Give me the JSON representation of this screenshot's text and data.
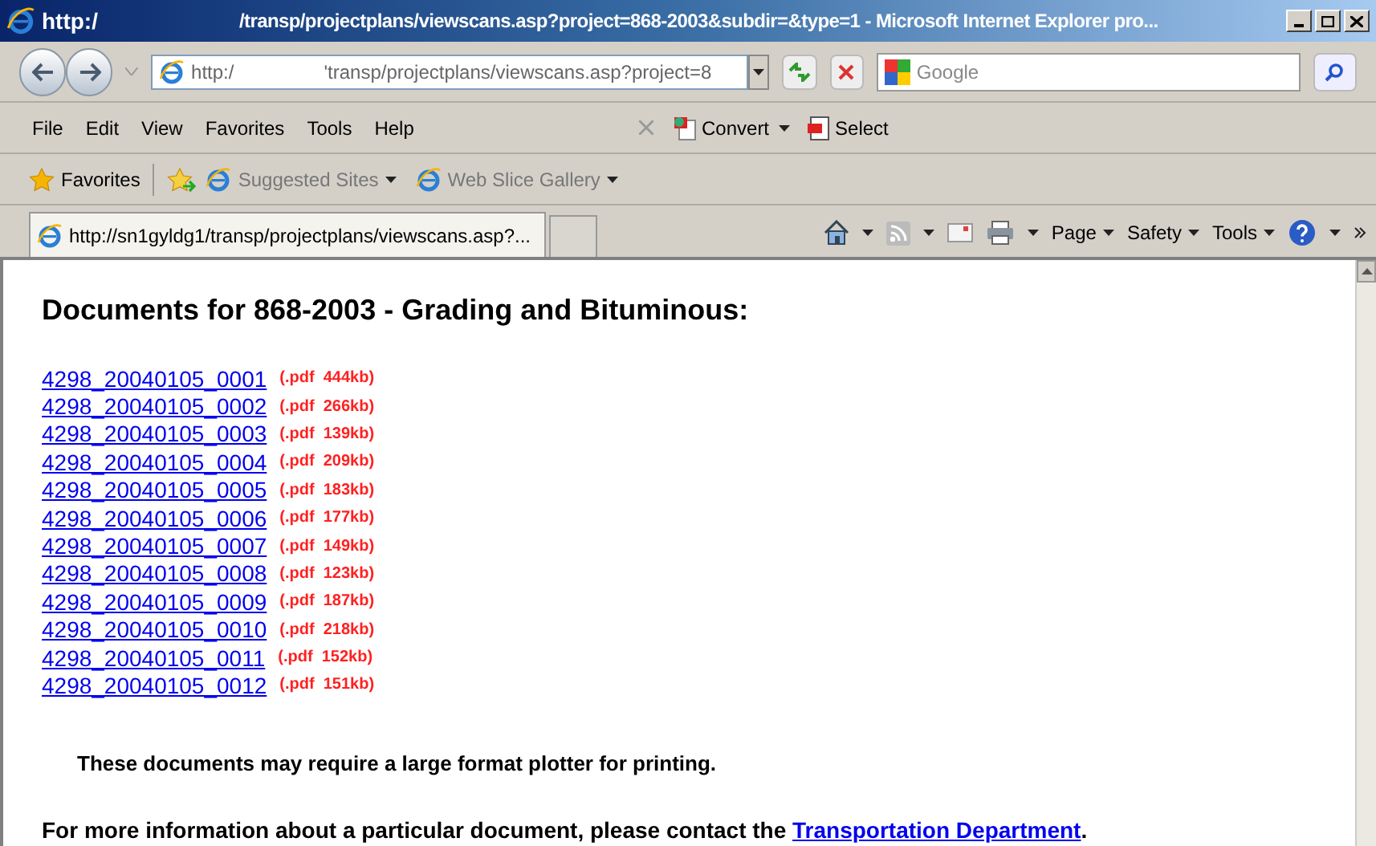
{
  "window": {
    "title_start": "http:/",
    "title_end": "/transp/projectplans/viewscans.asp?project=868-2003&subdir=&type=1 - Microsoft Internet Explorer pro..."
  },
  "address_bar": {
    "start": "http:/",
    "end": "'transp/projectplans/viewscans.asp?project=8"
  },
  "search": {
    "placeholder": "Google"
  },
  "menu": [
    "File",
    "Edit",
    "View",
    "Favorites",
    "Tools",
    "Help"
  ],
  "addon_buttons": [
    {
      "kind": "convert",
      "label": "Convert"
    },
    {
      "kind": "select",
      "label": "Select"
    }
  ],
  "favorites_bar": {
    "label": "Favorites",
    "items": [
      "Suggested Sites",
      "Web Slice Gallery"
    ]
  },
  "tabs": [
    {
      "label": "http://sn1gyldg1/transp/projectplans/viewscans.asp?...",
      "selected": true
    }
  ],
  "command_bar": [
    "Page",
    "Safety",
    "Tools"
  ],
  "page": {
    "heading": "Documents for 868-2003 - Grading and Bituminous:",
    "documents": [
      {
        "name": "4298_20040105_0001",
        "size": "(.pdf  444kb)"
      },
      {
        "name": "4298_20040105_0002",
        "size": "(.pdf  266kb)"
      },
      {
        "name": "4298_20040105_0003",
        "size": "(.pdf  139kb)"
      },
      {
        "name": "4298_20040105_0004",
        "size": "(.pdf  209kb)"
      },
      {
        "name": "4298_20040105_0005",
        "size": "(.pdf  183kb)"
      },
      {
        "name": "4298_20040105_0006",
        "size": "(.pdf  177kb)"
      },
      {
        "name": "4298_20040105_0007",
        "size": "(.pdf  149kb)"
      },
      {
        "name": "4298_20040105_0008",
        "size": "(.pdf  123kb)"
      },
      {
        "name": "4298_20040105_0009",
        "size": "(.pdf  187kb)"
      },
      {
        "name": "4298_20040105_0010",
        "size": "(.pdf  218kb)"
      },
      {
        "name": "4298_20040105_0011",
        "size": "(.pdf  152kb)"
      },
      {
        "name": "4298_20040105_0012",
        "size": "(.pdf  151kb)"
      }
    ],
    "note": "These documents may require a large format plotter for printing.",
    "contact": {
      "text": "For more information about a particular document, please contact the",
      "link": "Transportation Department",
      "end": "."
    }
  }
}
